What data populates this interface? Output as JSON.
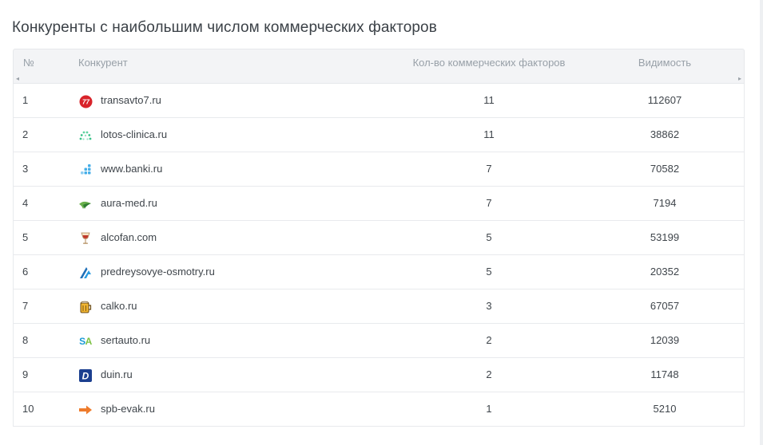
{
  "panel": {
    "title": "Конкуренты с наибольшим числом коммерческих факторов"
  },
  "table": {
    "columns": {
      "num": "№",
      "competitor": "Конкурент",
      "factors": "Кол-во коммерческих факторов",
      "visibility": "Видимость"
    },
    "rows": [
      {
        "num": "1",
        "site": "transavto7.ru",
        "factors": "11",
        "visibility": "112607",
        "icon": "transavto7-logo-icon",
        "icon_color": "#d8232a"
      },
      {
        "num": "2",
        "site": "lotos-clinica.ru",
        "factors": "11",
        "visibility": "38862",
        "icon": "lotos-clinica-logo-icon",
        "icon_color": "#3cc28a"
      },
      {
        "num": "3",
        "site": "www.banki.ru",
        "factors": "7",
        "visibility": "70582",
        "icon": "banki-logo-icon",
        "icon_color": "#46aee8"
      },
      {
        "num": "4",
        "site": "aura-med.ru",
        "factors": "7",
        "visibility": "7194",
        "icon": "aura-med-logo-icon",
        "icon_color": "#6ab04c"
      },
      {
        "num": "5",
        "site": "alcofan.com",
        "factors": "5",
        "visibility": "53199",
        "icon": "alcofan-logo-icon",
        "icon_color": "#c0392b"
      },
      {
        "num": "6",
        "site": "predreysovye-osmotry.ru",
        "factors": "5",
        "visibility": "20352",
        "icon": "predreysovye-logo-icon",
        "icon_color": "#1f6fb8"
      },
      {
        "num": "7",
        "site": "calko.ru",
        "factors": "3",
        "visibility": "67057",
        "icon": "calko-logo-icon",
        "icon_color": "#d99a1e"
      },
      {
        "num": "8",
        "site": "sertauto.ru",
        "factors": "2",
        "visibility": "12039",
        "icon": "sertauto-logo-icon",
        "icon_color": "#1a9ad6"
      },
      {
        "num": "9",
        "site": "duin.ru",
        "factors": "2",
        "visibility": "11748",
        "icon": "duin-logo-icon",
        "icon_color": "#1b3f8f"
      },
      {
        "num": "10",
        "site": "spb-evak.ru",
        "factors": "1",
        "visibility": "5210",
        "icon": "spb-evak-logo-icon",
        "icon_color": "#ee7b2b"
      }
    ]
  },
  "logos": {
    "transavto7": "77",
    "sertauto_s": "S",
    "sertauto_a": "A",
    "duin": "D"
  }
}
